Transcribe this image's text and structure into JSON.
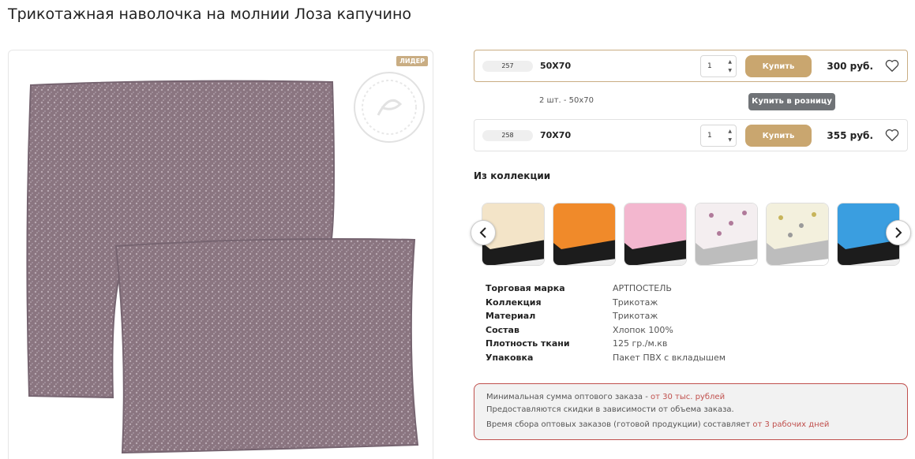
{
  "product": {
    "title": "Трикотажная наволочка на молнии Лоза капучино",
    "badge": "ЛИДЕР"
  },
  "variants": [
    {
      "sku": "257",
      "size": "50Х70",
      "qty": "1",
      "buy_label": "Купить",
      "price": "300 руб.",
      "selected": true
    },
    {
      "sku": "258",
      "size": "70Х70",
      "qty": "1",
      "buy_label": "Купить",
      "price": "355 руб.",
      "selected": false
    }
  ],
  "pack_note": "2 шт. - 50х70",
  "tooltip": "Купить в розницу",
  "collection": {
    "title": "Из коллекции",
    "thumbs": [
      {
        "name": "cream-sheet",
        "color": "#f3e4c8"
      },
      {
        "name": "orange-sheet",
        "color": "#f08a2a"
      },
      {
        "name": "pink-sheet",
        "color": "#f3b7cf"
      },
      {
        "name": "floral-pink-sheet",
        "color": "#f4eef0"
      },
      {
        "name": "floral-yellow-sheet",
        "color": "#f3f0dd"
      },
      {
        "name": "blue-sheet",
        "color": "#3a9ee0"
      }
    ]
  },
  "specs": [
    {
      "label": "Торговая марка",
      "value": "АРТПОСТЕЛЬ"
    },
    {
      "label": "Коллекция",
      "value": "Трикотаж"
    },
    {
      "label": "Материал",
      "value": "Трикотаж"
    },
    {
      "label": "Состав",
      "value": "Хлопок 100%"
    },
    {
      "label": "Плотность ткани",
      "value": "125 гр./м.кв"
    },
    {
      "label": "Упаковка",
      "value": "Пакет ПВХ с вкладышем"
    }
  ],
  "info": {
    "line1_text": "Минимальная сумма оптового заказа - ",
    "line1_highlight": "от 30 тыс. рублей",
    "line2_text": "Предоставляются скидки в зависимости от объема заказа.",
    "line3_text": "Время сбора оптовых заказов (готовой продукции) составляет ",
    "line3_highlight": "от 3 рабочих дней"
  },
  "colors": {
    "accent": "#c9a66f",
    "alert_border": "#c0504d",
    "pillow": "#8d7681"
  }
}
